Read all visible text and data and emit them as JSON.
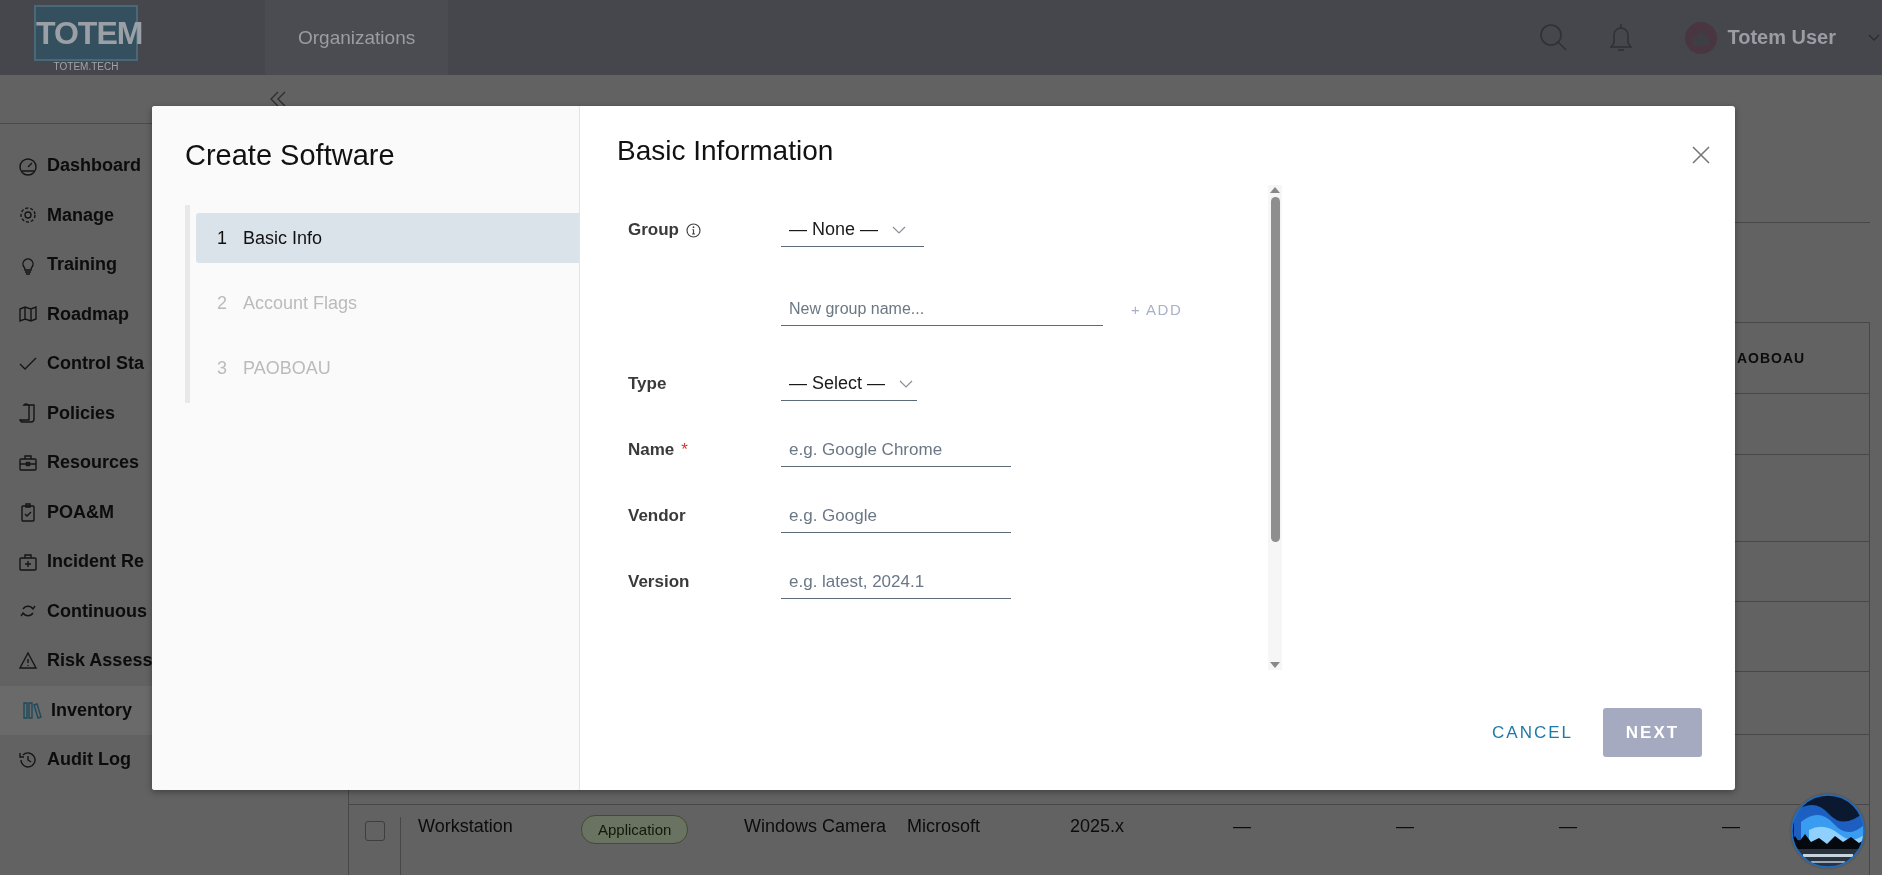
{
  "top_bar": {
    "logo": {
      "text": "TOTEM",
      "subtitle": "TOTEM.TECH"
    },
    "nav": [
      {
        "label": "Organizations"
      }
    ],
    "user": {
      "name": "Totem User"
    }
  },
  "sidebar": {
    "items": [
      {
        "label": "Dashboard",
        "selected": false
      },
      {
        "label": "Manage",
        "selected": false
      },
      {
        "label": "Training",
        "selected": false
      },
      {
        "label": "Roadmap",
        "selected": false
      },
      {
        "label": "Control Sta",
        "selected": false
      },
      {
        "label": "Policies",
        "selected": false
      },
      {
        "label": "Resources",
        "selected": false
      },
      {
        "label": "POA&M",
        "selected": false
      },
      {
        "label": "Incident Re",
        "selected": false
      },
      {
        "label": "Continuous",
        "selected": false
      },
      {
        "label": "Risk Assess",
        "selected": false
      },
      {
        "label": "Inventory",
        "selected": true
      },
      {
        "label": "Audit Log",
        "selected": false
      }
    ]
  },
  "table": {
    "columns": [
      {
        "label": "AOBOAU"
      }
    ],
    "rows": [
      {
        "checked": false,
        "cells": [
          {
            "text": "Workstation"
          },
          {
            "text": "Application",
            "kind": "tag"
          },
          {
            "text": "Windows Camera"
          },
          {
            "text": "Microsoft"
          },
          {
            "text": "2025.x"
          },
          {
            "text": "—"
          },
          {
            "text": "—"
          },
          {
            "text": "—"
          },
          {
            "text": "—"
          }
        ]
      }
    ]
  },
  "dialog": {
    "title": "Create Software",
    "steps": [
      {
        "number": "1",
        "label": "Basic Info",
        "selected": true
      },
      {
        "number": "2",
        "label": "Account Flags",
        "selected": false
      },
      {
        "number": "3",
        "label": "PAOBOAU",
        "selected": false
      }
    ],
    "section_title": "Basic Information",
    "fields": [
      {
        "kind": "select",
        "label": "Group",
        "info": true,
        "value": "— None —"
      },
      {
        "kind": "input",
        "placeholder": "New group name...",
        "action": "+ ADD"
      },
      {
        "kind": "select",
        "label": "Type",
        "value": "— Select —"
      },
      {
        "kind": "input",
        "label": "Name",
        "required": "*",
        "placeholder": "e.g. Google Chrome"
      },
      {
        "kind": "input",
        "label": "Vendor",
        "placeholder": "e.g. Google"
      },
      {
        "kind": "input",
        "label": "Version",
        "placeholder": "e.g. latest, 2024.1"
      }
    ],
    "buttons": [
      {
        "label": "CANCEL",
        "kind": "link",
        "disabled": false
      },
      {
        "label": "NEXT",
        "kind": "primary",
        "disabled": true
      }
    ]
  }
}
